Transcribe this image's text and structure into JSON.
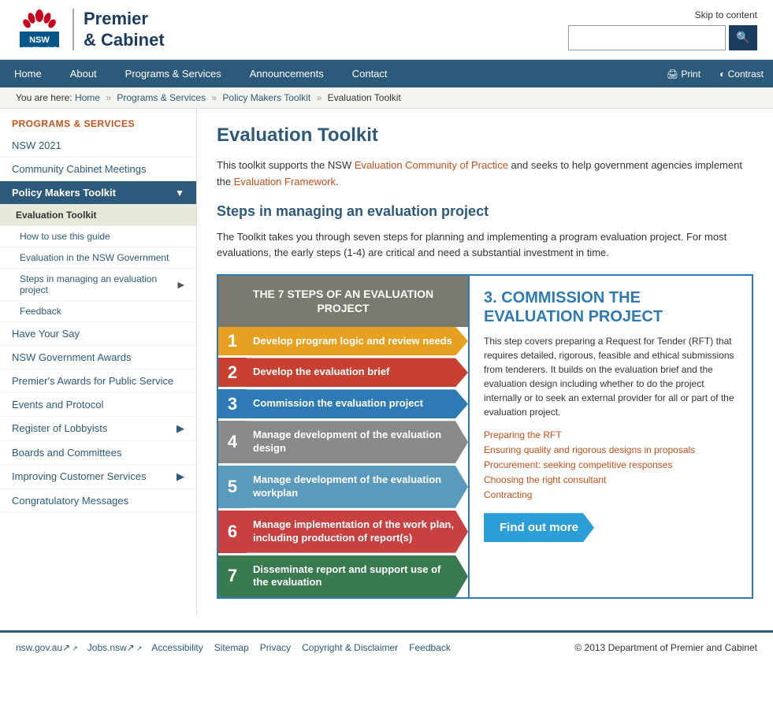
{
  "header": {
    "skip_link": "Skip to content",
    "logo_line1": "Premier",
    "logo_line2": "& Cabinet",
    "search_placeholder": "",
    "search_icon": "🔍"
  },
  "nav": {
    "items": [
      {
        "label": "Home",
        "active": false
      },
      {
        "label": "About",
        "active": false
      },
      {
        "label": "Programs & Services",
        "active": true
      },
      {
        "label": "Announcements",
        "active": false
      },
      {
        "label": "Contact",
        "active": false
      }
    ],
    "utilities": [
      {
        "label": "Print",
        "icon": "🖨"
      },
      {
        "label": "Contrast",
        "icon": "◐"
      }
    ]
  },
  "breadcrumb": {
    "prefix": "You are here:",
    "items": [
      "Home",
      "Programs & Services",
      "Policy Makers Toolkit",
      "Evaluation Toolkit"
    ]
  },
  "sidebar": {
    "section_title": "PROGRAMS & SERVICES",
    "items": [
      {
        "label": "NSW 2021",
        "type": "link",
        "indent": 0
      },
      {
        "label": "Community Cabinet Meetings",
        "type": "link",
        "indent": 0
      },
      {
        "label": "Policy Makers Toolkit",
        "type": "active-parent",
        "indent": 0
      },
      {
        "label": "Evaluation Toolkit",
        "type": "active-child",
        "indent": 1
      },
      {
        "label": "How to use this guide",
        "type": "subitem",
        "indent": 2
      },
      {
        "label": "Evaluation in the NSW Government",
        "type": "subitem",
        "indent": 2
      },
      {
        "label": "Steps in managing an evaluation project",
        "type": "subitem",
        "indent": 2,
        "has_arrow": true
      },
      {
        "label": "Feedback",
        "type": "subitem",
        "indent": 2
      },
      {
        "label": "Have Your Say",
        "type": "link",
        "indent": 0
      },
      {
        "label": "NSW Government Awards",
        "type": "link",
        "indent": 0
      },
      {
        "label": "Premier's Awards for Public Service",
        "type": "link",
        "indent": 0
      },
      {
        "label": "Events and Protocol",
        "type": "link",
        "indent": 0
      },
      {
        "label": "Register of Lobbyists",
        "type": "link",
        "indent": 0,
        "has_arrow": true
      },
      {
        "label": "Boards and Committees",
        "type": "link",
        "indent": 0
      },
      {
        "label": "Improving Customer Services",
        "type": "link",
        "indent": 0,
        "has_arrow": true
      },
      {
        "label": "Congratulatory Messages",
        "type": "link",
        "indent": 0
      }
    ]
  },
  "content": {
    "page_title": "Evaluation Toolkit",
    "intro_text": "This toolkit supports the NSW Evaluation Community of Practice and seeks to help government agencies implement the Evaluation Framework.",
    "steps_section_title": "Steps in managing an evaluation project",
    "body_text": "The Toolkit takes you through seven steps for planning and implementing a program evaluation project. For most evaluations, the early steps (1-4) are critical and need a substantial investment in time.",
    "diagram": {
      "header": "THE 7 STEPS OF AN EVALUATION PROJECT",
      "steps": [
        {
          "num": "1",
          "label": "Develop program logic and review needs",
          "color_class": "step-1",
          "num_color": "step-num-1"
        },
        {
          "num": "2",
          "label": "Develop the evaluation brief",
          "color_class": "step-2",
          "num_color": "step-num-2"
        },
        {
          "num": "3",
          "label": "Commission the evaluation project",
          "color_class": "step-3",
          "num_color": "step-num-3"
        },
        {
          "num": "4",
          "label": "Manage development of the evaluation design",
          "color_class": "step-4",
          "num_color": "step-num-4"
        },
        {
          "num": "5",
          "label": "Manage development of the evaluation workplan",
          "color_class": "step-5",
          "num_color": "step-num-5"
        },
        {
          "num": "6",
          "label": "Manage implementation of the work plan, including production of report(s)",
          "color_class": "step-6",
          "num_color": "step-num-6"
        },
        {
          "num": "7",
          "label": "Disseminate report and support use of the evaluation",
          "color_class": "step-7",
          "num_color": "step-num-7"
        }
      ]
    },
    "panel": {
      "title": "3. COMMISSION THE EVALUATION PROJECT",
      "description": "This step covers preparing a Request for Tender (RFT) that requires detailed, rigorous, feasible and ethical submissions from tenderers. It builds on the evaluation brief and the evaluation design including whether to do the project internally or to seek an external provider for all or part of the evaluation project.",
      "links": [
        "Preparing the RFT",
        "Ensuring quality and rigorous designs in proposals",
        "Procurement: seeking competitive responses",
        "Choosing the right consultant",
        "Contracting"
      ],
      "find_out_more": "Find out more"
    }
  },
  "footer": {
    "links": [
      {
        "label": "nsw.gov.au",
        "has_icon": true
      },
      {
        "label": "Jobs.nsw",
        "has_icon": true
      },
      {
        "label": "Accessibility",
        "has_icon": false
      },
      {
        "label": "Sitemap",
        "has_icon": false
      },
      {
        "label": "Privacy",
        "has_icon": false
      },
      {
        "label": "Copyright & Disclaimer",
        "has_icon": false
      },
      {
        "label": "Feedback",
        "has_icon": false
      }
    ],
    "copyright": "© 2013 Department of Premier and Cabinet"
  }
}
